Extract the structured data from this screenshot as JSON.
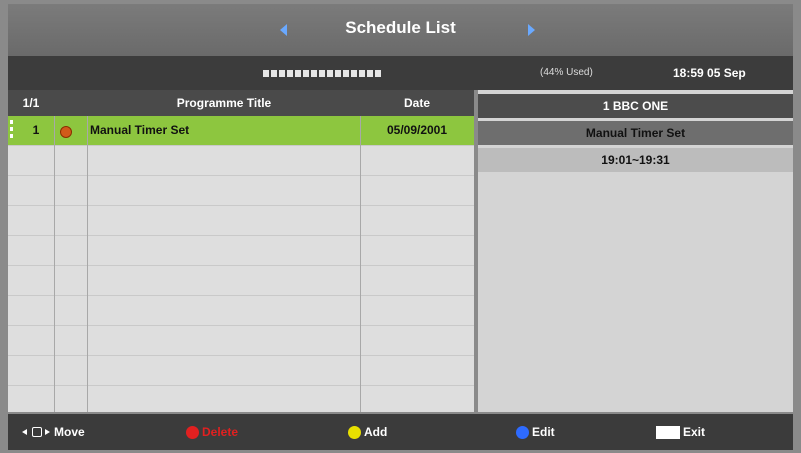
{
  "header": {
    "title": "Schedule List"
  },
  "status": {
    "usage_text": "(44% Used)",
    "clock": "18:59 05 Sep"
  },
  "list": {
    "headers": {
      "count": "1/1",
      "title": "Programme Title",
      "date": "Date"
    },
    "rows": [
      {
        "index": "1",
        "title": "Manual Timer Set",
        "date": "05/09/2001"
      }
    ]
  },
  "detail": {
    "channel": "1 BBC ONE",
    "name": "Manual Timer Set",
    "time": "19:01~19:31"
  },
  "footer": {
    "move": "Move",
    "delete": "Delete",
    "add": "Add",
    "edit": "Edit",
    "exit": "Exit"
  },
  "colors": {
    "selected_row": "#8dc63f",
    "delete_key": "#e12020",
    "add_key": "#e8e000",
    "edit_key": "#2e6bff"
  }
}
